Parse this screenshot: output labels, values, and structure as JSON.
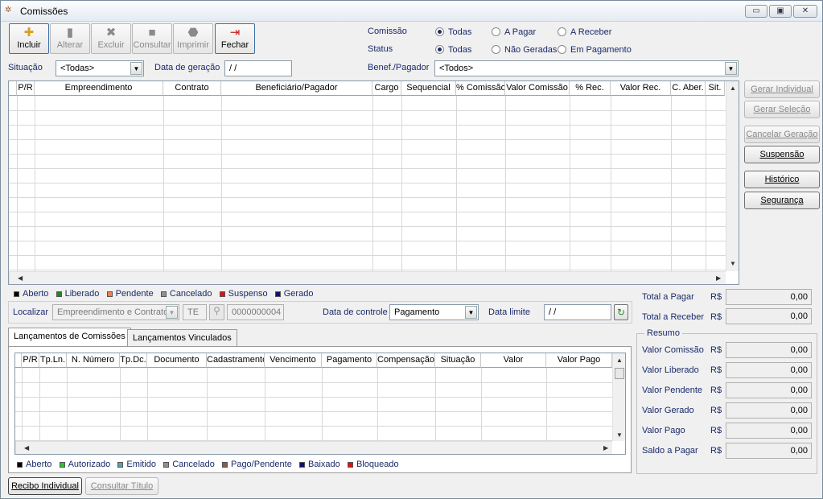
{
  "window": {
    "title": "Comissões",
    "buttons": [
      "▭",
      "▣",
      "✕"
    ]
  },
  "toolbar": [
    {
      "label": "Incluir",
      "icon": "new-icon",
      "enabled": true
    },
    {
      "label": "Alterar",
      "icon": "edit-icon",
      "enabled": false
    },
    {
      "label": "Excluir",
      "icon": "delete-icon",
      "enabled": false
    },
    {
      "label": "Consultar",
      "icon": "view-icon",
      "enabled": false
    },
    {
      "label": "Imprimir",
      "icon": "print-icon",
      "enabled": false
    },
    {
      "label": "Fechar",
      "icon": "exit-icon",
      "enabled": true
    }
  ],
  "filters": {
    "comissao_label": "Comissão",
    "status_label": "Status",
    "comissao_options": [
      "Todas",
      "A Pagar",
      "A Receber"
    ],
    "status_options": [
      "Todas",
      "Não Geradas",
      "Em Pagamento"
    ],
    "situacao_label": "Situação",
    "situacao_value": "<Todas>",
    "data_geracao_label": "Data de geração",
    "data_geracao_value": " /  /",
    "benef_label": "Benef./Pagador",
    "benef_value": "<Todos>"
  },
  "main_grid": {
    "columns": [
      "P/R",
      "Empreendimento",
      "Contrato",
      "Beneficiário/Pagador",
      "Cargo",
      "Sequencial",
      "% Comissão",
      "Valor Comissão",
      "% Rec.",
      "Valor Rec.",
      "C. Aber.",
      "Sit."
    ]
  },
  "side_buttons": [
    {
      "label": "Gerar Individual",
      "enabled": false
    },
    {
      "label": "Gerar Seleção",
      "enabled": false
    },
    {
      "label": "Cancelar Geração",
      "enabled": false
    },
    {
      "label": "Suspensão",
      "enabled": true
    },
    {
      "label": "Histórico",
      "enabled": true
    },
    {
      "label": "Segurança",
      "enabled": true
    }
  ],
  "legend1": [
    {
      "label": "Aberto",
      "color": "#000000"
    },
    {
      "label": "Liberado",
      "color": "#1e8a1e"
    },
    {
      "label": "Pendente",
      "color": "#f08050"
    },
    {
      "label": "Cancelado",
      "color": "#909090"
    },
    {
      "label": "Suspenso",
      "color": "#e01010"
    },
    {
      "label": "Gerado",
      "color": "#101070"
    }
  ],
  "totals": {
    "pagar_label": "Total a Pagar",
    "receber_label": "Total a Receber",
    "currency": "R$",
    "pagar_value": "0,00",
    "receber_value": "0,00"
  },
  "locate": {
    "label": "Localizar",
    "field_value": "Empreendimento e Contrato",
    "code": "TE",
    "number": "0000000004",
    "controle_label": "Data de controle",
    "controle_value": "Pagamento",
    "limite_label": "Data limite",
    "limite_value": " /  /"
  },
  "tabs": [
    "Lançamentos de Comissões",
    "Lançamentos Vinculados"
  ],
  "sub_grid": {
    "columns": [
      "P/R",
      "Tp.Ln.",
      "N. Número",
      "Tp.Dc.",
      "Documento",
      "Cadastramento",
      "Vencimento",
      "Pagamento",
      "Compensação",
      "Situação",
      "Valor",
      "Valor Pago"
    ]
  },
  "legend2": [
    {
      "label": "Aberto",
      "color": "#000000"
    },
    {
      "label": "Autorizado",
      "color": "#30c030"
    },
    {
      "label": "Emitido",
      "color": "#60a0a0"
    },
    {
      "label": "Cancelado",
      "color": "#909090"
    },
    {
      "label": "Pago/Pendente",
      "color": "#806050"
    },
    {
      "label": "Baixado",
      "color": "#101070"
    },
    {
      "label": "Bloqueado",
      "color": "#e01010"
    }
  ],
  "resumo": {
    "title": "Resumo",
    "currency": "R$",
    "rows": [
      {
        "label": "Valor Comissão",
        "value": "0,00"
      },
      {
        "label": "Valor Liberado",
        "value": "0,00"
      },
      {
        "label": "Valor Pendente",
        "value": "0,00"
      },
      {
        "label": "Valor Gerado",
        "value": "0,00"
      },
      {
        "label": "Valor Pago",
        "value": "0,00"
      },
      {
        "label": "Saldo a Pagar",
        "value": "0,00"
      }
    ]
  },
  "bottom_buttons": [
    {
      "label": "Recibo Individual",
      "enabled": true
    },
    {
      "label": "Consultar Título",
      "enabled": false
    }
  ]
}
